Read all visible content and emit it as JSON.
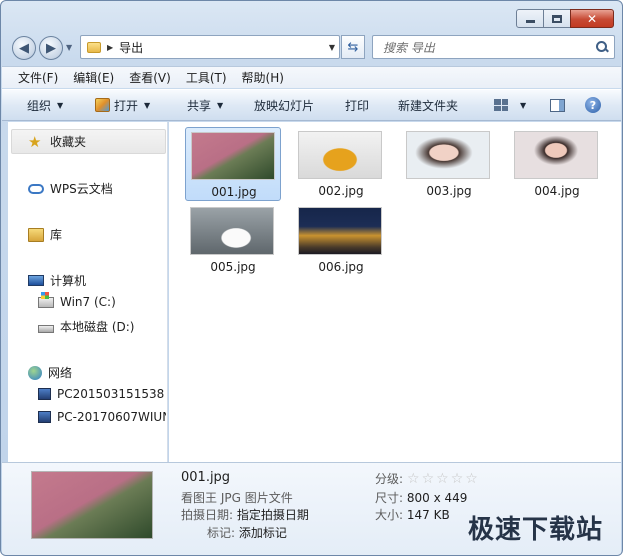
{
  "window": {
    "caption_buttons": [
      "minimize",
      "maximize",
      "close"
    ]
  },
  "address": {
    "crumb": "导出"
  },
  "search": {
    "placeholder": "搜索 导出"
  },
  "menu": [
    "文件(F)",
    "编辑(E)",
    "查看(V)",
    "工具(T)",
    "帮助(H)"
  ],
  "commands": {
    "organize": "组织",
    "open": "打开",
    "share": "共享",
    "slideshow": "放映幻灯片",
    "print": "打印",
    "new_folder": "新建文件夹"
  },
  "nav": {
    "favorites": "收藏夹",
    "wps_cloud": "WPS云文档",
    "libraries": "库",
    "computer": "计算机",
    "drive_c": "Win7 (C:)",
    "drive_d": "本地磁盘 (D:)",
    "network": "网络",
    "host1": "PC201503151538",
    "host2": "PC-20170607WIUN"
  },
  "files": [
    {
      "name": "001.jpg",
      "thumb": "aerial-forest",
      "selected": true
    },
    {
      "name": "002.jpg",
      "thumb": "yellow-suv",
      "selected": false
    },
    {
      "name": "003.jpg",
      "thumb": "portrait-woman",
      "selected": false
    },
    {
      "name": "004.jpg",
      "thumb": "portrait-woman-red",
      "selected": false
    },
    {
      "name": "005.jpg",
      "thumb": "white-sports-car",
      "selected": false
    },
    {
      "name": "006.jpg",
      "thumb": "night-city",
      "selected": false
    }
  ],
  "details": {
    "filename": "001.jpg",
    "type": "看图王 JPG 图片文件",
    "date_label": "拍摄日期:",
    "date_value": "指定拍摄日期",
    "tags_label": "标记:",
    "tags_value": "添加标记",
    "rating_label": "分级:",
    "rating": 0,
    "rating_max": 5,
    "dims_label": "尺寸:",
    "dims_value": "800 x 449",
    "size_label": "大小:",
    "size_value": "147 KB"
  },
  "watermark": "极速下载站",
  "colors": {
    "selection": "#c1dcfa",
    "titlebar": "#c9daed",
    "close": "#c74a34"
  }
}
